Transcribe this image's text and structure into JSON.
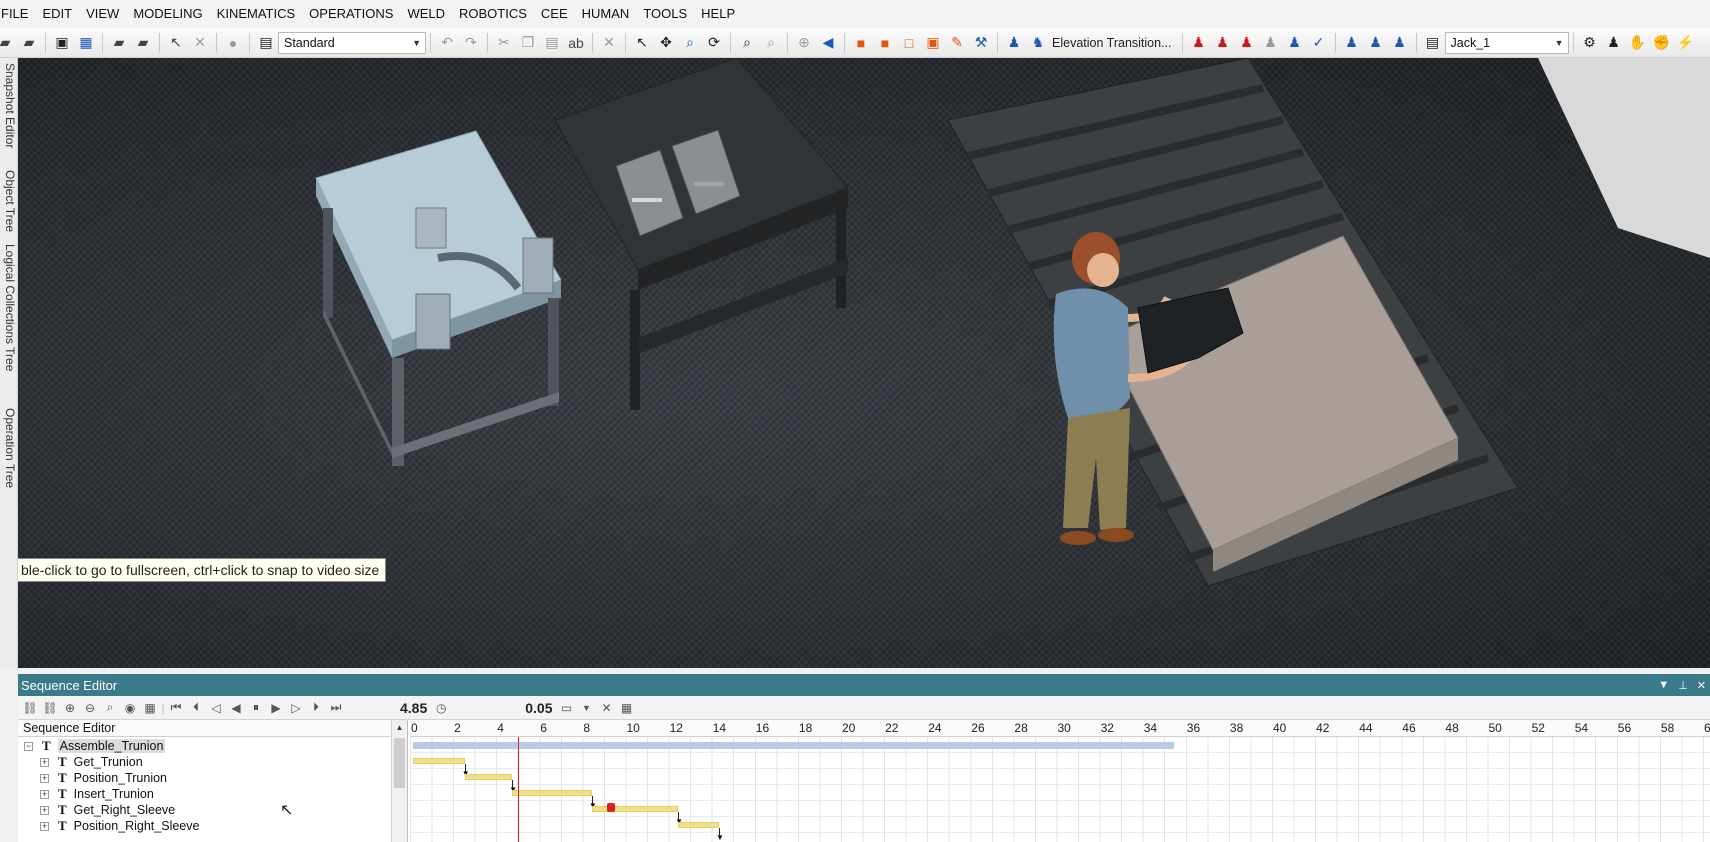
{
  "menu": [
    "FILE",
    "EDIT",
    "VIEW",
    "MODELING",
    "KINEMATICS",
    "OPERATIONS",
    "WELD",
    "ROBOTICS",
    "CEE",
    "HUMAN",
    "TOOLS",
    "HELP"
  ],
  "toolbar": {
    "view_mode": "Standard",
    "elevation_label": "Elevation Transition...",
    "human_select": "Jack_1"
  },
  "left_tabs": [
    "Snapshot Editor",
    "Object Tree",
    "Logical Collections Tree",
    "Operation Tree"
  ],
  "viewport": {
    "tooltip": "ble-click to go to fullscreen, ctrl+click to snap to video size"
  },
  "sequence_editor": {
    "title": "Sequence Editor",
    "current_time": "4.85",
    "step": "0.05",
    "tree_header": "Sequence Editor",
    "rows": [
      {
        "label": "Assemble_Trunion",
        "type": "T",
        "expander": "−"
      },
      {
        "label": "Get_Trunion",
        "type": "T",
        "expander": "+"
      },
      {
        "label": "Position_Trunion",
        "type": "T",
        "expander": "+"
      },
      {
        "label": "Insert_Trunion",
        "type": "T",
        "expander": "+"
      },
      {
        "label": "Get_Right_Sleeve",
        "type": "T",
        "expander": "+"
      },
      {
        "label": "Position_Right_Sleeve",
        "type": "T",
        "expander": "+"
      }
    ],
    "ticks": [
      "0",
      "2",
      "4",
      "6",
      "8",
      "10",
      "12",
      "14",
      "16",
      "18",
      "20",
      "22",
      "24",
      "26",
      "28",
      "30",
      "32",
      "34",
      "36",
      "38",
      "40",
      "42",
      "44",
      "46",
      "48",
      "50",
      "52",
      "54",
      "56",
      "58",
      "6"
    ],
    "tasks": [
      {
        "name": "Get_Trunion",
        "start": 0,
        "end": 2.4
      },
      {
        "name": "Position_Trunion",
        "start": 2.4,
        "end": 4.6
      },
      {
        "name": "Insert_Trunion",
        "start": 4.6,
        "end": 8.3
      },
      {
        "name": "Get_Right_Sleeve",
        "start": 8.3,
        "end": 12.3
      },
      {
        "name": "Position_Right_Sleeve",
        "start": 12.3,
        "end": 14.2
      }
    ],
    "summary": {
      "start": 0,
      "end": 35.3
    }
  }
}
